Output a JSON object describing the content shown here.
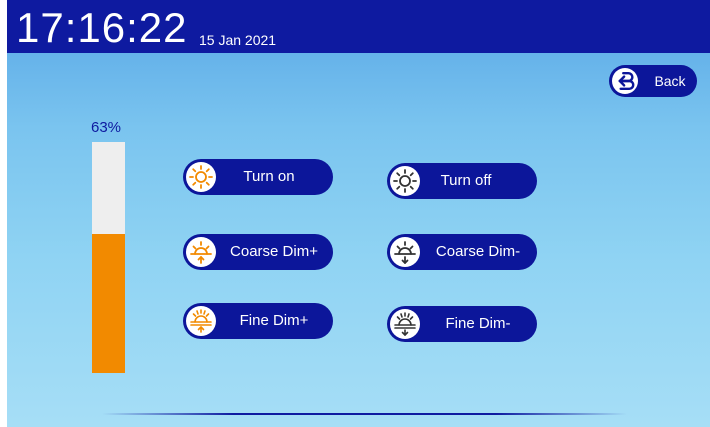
{
  "header": {
    "time": "17:16:22",
    "date": "15 Jan 2021"
  },
  "back_button": {
    "label": "Back",
    "icon": "back-arrow-icon"
  },
  "level": {
    "percent_label": "63%",
    "value": 0.6,
    "fill_color": "#f28a00",
    "track_color": "#eeeeee"
  },
  "controls": {
    "turn_on": {
      "label": "Turn on",
      "icon": "sun-icon"
    },
    "turn_off": {
      "label": "Turn off",
      "icon": "sun-outline-icon"
    },
    "coarse_dim_plus": {
      "label": "Coarse Dim+",
      "icon": "sunrise-up-icon"
    },
    "coarse_dim_minus": {
      "label": "Coarse Dim-",
      "icon": "sunset-down-icon"
    },
    "fine_dim_plus": {
      "label": "Fine Dim+",
      "icon": "sunrise-fine-up-icon"
    },
    "fine_dim_minus": {
      "label": "Fine Dim-",
      "icon": "sunset-fine-down-icon"
    }
  },
  "colors": {
    "header_bg": "#0e1aa0",
    "button_bg": "#0c169a",
    "icon_on": "#f28a00",
    "icon_off": "#333333"
  }
}
